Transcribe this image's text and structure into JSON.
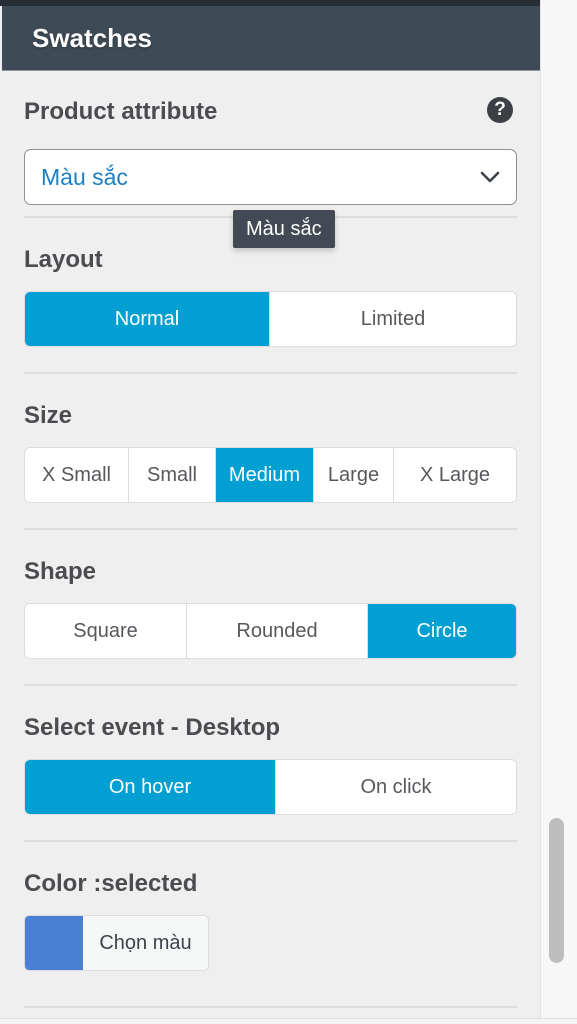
{
  "header": {
    "title": "Swatches"
  },
  "product_attribute": {
    "label": "Product attribute",
    "help_icon": "question-circle-icon",
    "select_value": "Màu sắc",
    "tooltip": "Màu sắc"
  },
  "layout": {
    "label": "Layout",
    "options": [
      {
        "label": "Normal",
        "active": true
      },
      {
        "label": "Limited",
        "active": false
      }
    ]
  },
  "size": {
    "label": "Size",
    "options": [
      {
        "label": "X Small",
        "active": false
      },
      {
        "label": "Small",
        "active": false
      },
      {
        "label": "Medium",
        "active": true
      },
      {
        "label": "Large",
        "active": false
      },
      {
        "label": "X Large",
        "active": false
      }
    ]
  },
  "shape": {
    "label": "Shape",
    "options": [
      {
        "label": "Square",
        "active": false
      },
      {
        "label": "Rounded",
        "active": false
      },
      {
        "label": "Circle",
        "active": true
      }
    ]
  },
  "select_event": {
    "label": "Select event - Desktop",
    "options": [
      {
        "label": "On hover",
        "active": true
      },
      {
        "label": "On click",
        "active": false
      }
    ]
  },
  "color_selected": {
    "label": "Color :selected",
    "swatch_color": "#4a7fd3",
    "button_label": "Chọn màu"
  },
  "colors": {
    "accent": "#02a0d2",
    "header_bg": "#3e4b57",
    "select_text": "#1a7fc4"
  }
}
